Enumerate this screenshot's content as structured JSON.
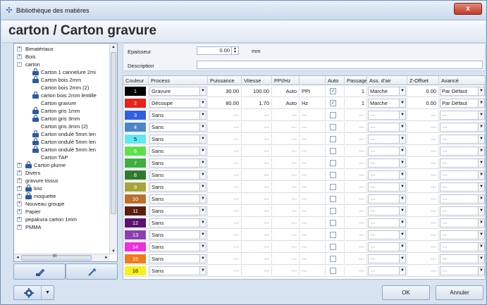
{
  "window": {
    "title": "Bibliothèque des matières",
    "close_label": "x"
  },
  "header": {
    "title": "carton / Carton gravure"
  },
  "tree": {
    "items": [
      {
        "label": "Bimatériaux",
        "level": 0,
        "expander": "+",
        "locked": false
      },
      {
        "label": "Bois",
        "level": 0,
        "expander": "+",
        "locked": false
      },
      {
        "label": "carton",
        "level": 0,
        "expander": "-",
        "locked": false
      },
      {
        "label": "Carton 1 cannelure 2mi",
        "level": 1,
        "expander": "",
        "locked": true
      },
      {
        "label": "Carton bois 2mm",
        "level": 1,
        "expander": "",
        "locked": true
      },
      {
        "label": "Carton bois 2mm (2)",
        "level": 1,
        "expander": "",
        "locked": false
      },
      {
        "label": "carton bois 2mm lentille",
        "level": 1,
        "expander": "",
        "locked": true
      },
      {
        "label": "Carton gravure",
        "level": 1,
        "expander": "",
        "locked": false
      },
      {
        "label": "Carton gris 1mm",
        "level": 1,
        "expander": "",
        "locked": true
      },
      {
        "label": "Carton gris 3mm",
        "level": 1,
        "expander": "",
        "locked": true
      },
      {
        "label": "Carton gris 3mm (2)",
        "level": 1,
        "expander": "",
        "locked": false
      },
      {
        "label": "Carton ondulé 5mm len",
        "level": 1,
        "expander": "",
        "locked": true
      },
      {
        "label": "Carton ondulé 5mm len",
        "level": 1,
        "expander": "",
        "locked": true
      },
      {
        "label": "Carton ondulé 5mm len",
        "level": 1,
        "expander": "",
        "locked": true
      },
      {
        "label": "Carton TAP",
        "level": 1,
        "expander": "",
        "locked": false
      },
      {
        "label": "Carton plume",
        "level": 0,
        "expander": "+",
        "locked": true
      },
      {
        "label": "Divers",
        "level": 0,
        "expander": "+",
        "locked": false
      },
      {
        "label": "gravure tissus",
        "level": 0,
        "expander": "+",
        "locked": false
      },
      {
        "label": "lino",
        "level": 0,
        "expander": "+",
        "locked": true
      },
      {
        "label": "moquette",
        "level": 0,
        "expander": "+",
        "locked": true
      },
      {
        "label": "Nouveau groupe",
        "level": 0,
        "expander": "+",
        "locked": false
      },
      {
        "label": "Papier",
        "level": 0,
        "expander": "+",
        "locked": false
      },
      {
        "label": "pepakura carton 1mm",
        "level": 0,
        "expander": "+",
        "locked": false
      },
      {
        "label": "PMMA",
        "level": 0,
        "expander": "+",
        "locked": false
      }
    ],
    "hscroll_grip": "III"
  },
  "props": {
    "thickness_label": "Epaisseur",
    "thickness_value": "0.00",
    "thickness_unit": "mm",
    "description_label": "Description",
    "description_value": ""
  },
  "grid": {
    "headers": [
      "Couleur",
      "Process",
      "Puissance",
      "Vitesse",
      "PPI/Hz",
      "",
      "Auto",
      "Passage",
      "Ass. d'air",
      "Z-Offset",
      "Avancé"
    ],
    "rows": [
      {
        "num": "1",
        "color": "#000000",
        "text_color": "#ffffff",
        "process": "Gravure",
        "power": "30.00",
        "speed": "100.00",
        "ppi": "Auto",
        "ppi_unit": "PPI",
        "auto": true,
        "passes": "1",
        "air": "Marche",
        "zoffset": "0.00",
        "advanced": "Par Défaut"
      },
      {
        "num": "2",
        "color": "#e8211c",
        "text_color": "#ffffff",
        "process": "Découpe",
        "power": "80.00",
        "speed": "1.70",
        "ppi": "Auto",
        "ppi_unit": "Hz",
        "auto": true,
        "passes": "1",
        "air": "Marche",
        "zoffset": "0.00",
        "advanced": "Par Défaut"
      },
      {
        "num": "3",
        "color": "#2f5fe0",
        "text_color": "#ffffff",
        "process": "Sans",
        "power": "---",
        "speed": "---",
        "ppi": "---",
        "ppi_unit": "---",
        "auto": false,
        "passes": "---",
        "air": "---",
        "zoffset": "---",
        "advanced": "---"
      },
      {
        "num": "4",
        "color": "#4c86c6",
        "text_color": "#ffffff",
        "process": "Sans",
        "power": "---",
        "speed": "---",
        "ppi": "---",
        "ppi_unit": "---",
        "auto": false,
        "passes": "---",
        "air": "---",
        "zoffset": "---",
        "advanced": "---"
      },
      {
        "num": "5",
        "color": "#62e7ee",
        "text_color": "#000000",
        "process": "Sans",
        "power": "---",
        "speed": "---",
        "ppi": "---",
        "ppi_unit": "---",
        "auto": false,
        "passes": "---",
        "air": "---",
        "zoffset": "---",
        "advanced": "---"
      },
      {
        "num": "6",
        "color": "#5ee04b",
        "text_color": "#ffffff",
        "process": "Sans",
        "power": "---",
        "speed": "---",
        "ppi": "---",
        "ppi_unit": "---",
        "auto": false,
        "passes": "---",
        "air": "---",
        "zoffset": "---",
        "advanced": "---"
      },
      {
        "num": "7",
        "color": "#3fad3f",
        "text_color": "#ffffff",
        "process": "Sans",
        "power": "---",
        "speed": "---",
        "ppi": "---",
        "ppi_unit": "---",
        "auto": false,
        "passes": "---",
        "air": "---",
        "zoffset": "---",
        "advanced": "---"
      },
      {
        "num": "8",
        "color": "#2f7a30",
        "text_color": "#ffffff",
        "process": "Sans",
        "power": "---",
        "speed": "---",
        "ppi": "---",
        "ppi_unit": "---",
        "auto": false,
        "passes": "---",
        "air": "---",
        "zoffset": "---",
        "advanced": "---"
      },
      {
        "num": "9",
        "color": "#a8a33a",
        "text_color": "#ffffff",
        "process": "Sans",
        "power": "---",
        "speed": "---",
        "ppi": "---",
        "ppi_unit": "---",
        "auto": false,
        "passes": "---",
        "air": "---",
        "zoffset": "---",
        "advanced": "---"
      },
      {
        "num": "10",
        "color": "#b9722c",
        "text_color": "#ffffff",
        "process": "Sans",
        "power": "---",
        "speed": "---",
        "ppi": "---",
        "ppi_unit": "---",
        "auto": false,
        "passes": "---",
        "air": "---",
        "zoffset": "---",
        "advanced": "---"
      },
      {
        "num": "11",
        "color": "#5a1f10",
        "text_color": "#ffffff",
        "process": "Sans",
        "power": "---",
        "speed": "---",
        "ppi": "---",
        "ppi_unit": "---",
        "auto": false,
        "passes": "---",
        "air": "---",
        "zoffset": "---",
        "advanced": "---"
      },
      {
        "num": "12",
        "color": "#5b1270",
        "text_color": "#ffffff",
        "process": "Sans",
        "power": "---",
        "speed": "---",
        "ppi": "---",
        "ppi_unit": "---",
        "auto": false,
        "passes": "---",
        "air": "---",
        "zoffset": "---",
        "advanced": "---"
      },
      {
        "num": "13",
        "color": "#8d3fb0",
        "text_color": "#ffffff",
        "process": "Sans",
        "power": "---",
        "speed": "---",
        "ppi": "---",
        "ppi_unit": "---",
        "auto": false,
        "passes": "---",
        "air": "---",
        "zoffset": "---",
        "advanced": "---"
      },
      {
        "num": "14",
        "color": "#ee2fe0",
        "text_color": "#ffffff",
        "process": "Sans",
        "power": "---",
        "speed": "---",
        "ppi": "---",
        "ppi_unit": "---",
        "auto": false,
        "passes": "---",
        "air": "---",
        "zoffset": "---",
        "advanced": "---"
      },
      {
        "num": "15",
        "color": "#f07a1c",
        "text_color": "#ffffff",
        "process": "Sans",
        "power": "---",
        "speed": "---",
        "ppi": "---",
        "ppi_unit": "---",
        "auto": false,
        "passes": "---",
        "air": "---",
        "zoffset": "---",
        "advanced": "---"
      },
      {
        "num": "16",
        "color": "#f6f01d",
        "text_color": "#000000",
        "process": "Sans",
        "power": "---",
        "speed": "---",
        "ppi": "---",
        "ppi_unit": "---",
        "auto": false,
        "passes": "---",
        "air": "---",
        "zoffset": "---",
        "advanced": "---"
      }
    ]
  },
  "buttons": {
    "ok": "OK",
    "cancel": "Annuler"
  },
  "icons": {
    "tree_item_lock": "lock-icon",
    "edit_material": "pencil-edit-icon",
    "magic_tool": "wand-icon",
    "settings": "gear-icon"
  }
}
